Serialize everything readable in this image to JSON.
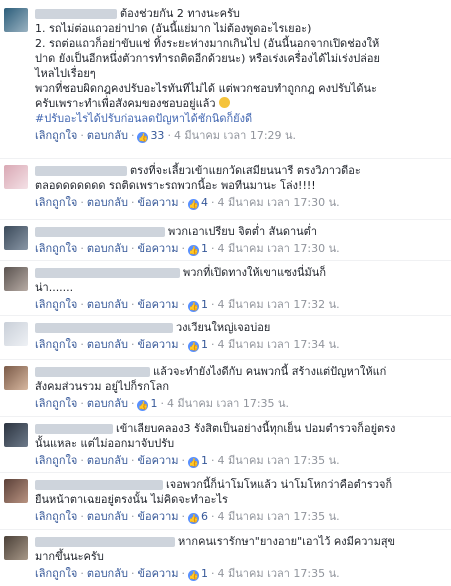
{
  "labels": {
    "like": "เลิกถูกใจ",
    "reply": "ตอบกลับ",
    "message": "ข้อความ"
  },
  "colors": {
    "link": "#365899",
    "meta": "#90949c",
    "hashtag": "#4267b2",
    "like_badge": "#5890ff"
  },
  "icons": {
    "like": "thumbs-up-icon",
    "emoji": "smile-emoji-icon"
  },
  "comments": [
    {
      "lines": [
        "ต้องช่วยกัน 2 ทางนะครับ",
        "1. รถไม่ต่อแถวอย่าปาด (อันนี้แย่มาก ไม่ต้องพูดอะไรเยอะ)",
        "2. รถต่อแถวก็อย่าขับแช่ ทิ้งระยะห่างมากเกินไป (อันนี้นอกจากเปิดช่องให้",
        "ปาด ยังเป็นอีกหนึ่งตัวการทำรถติดอีกด้วยนะ) หรือเร่งเครื่องได้ไม่เร่งปล่อย",
        "ไหลไปเรื่อยๆ",
        "พวกที่ชอบผิดกฎคงปรับอะไรทันทีไม่ได้ แต่พวกชอบทำถูกกฎ คงปรับได้นะ",
        "ครับเพราะทำเพื่อสังคมของชอบอยู่แล้ว",
        "#ปรับอะไรได้ปรับก่อนลดปัญหาได้ชักนิดก็ยังดี"
      ],
      "likes": "33",
      "time": "4 มีนาคม เวลา 17:29 น."
    },
    {
      "lines": [
        "ตรงที่จะเลี้ยวเข้าแยกวัดเสมียนนารี ตรงวิภาวดีอะ",
        "ตลอดดดดดดด รถติดเพราะรถพวกนี้อะ พอทีนมานะ โล่ง!!!!"
      ],
      "likes": "4",
      "time": "4 มีนาคม เวลา 17:30 น."
    },
    {
      "lines": [
        "พวกเอาเปรียบ จิตต่ำ สันดานต่ำ"
      ],
      "likes": "1",
      "time": "4 มีนาคม เวลา 17:30 น."
    },
    {
      "lines": [
        "พวกที่เปิดทางให้เขาแซงนี่มันก็",
        "น่า......."
      ],
      "likes": "1",
      "time": "4 มีนาคม เวลา 17:32 น."
    },
    {
      "lines": [
        "วงเวียนใหญ่เจอบ่อย"
      ],
      "likes": "1",
      "time": "4 มีนาคม เวลา 17:34 น."
    },
    {
      "lines": [
        "แล้วจะทำยังไงดีกับ คนพวกนี้ สร้างแต่ปัญหาให้แก่",
        "สังคมส่วนรวม อยู่ไปก็รกโลก"
      ],
      "likes": "1",
      "time": "4 มีนาคม เวลา 17:35 น."
    },
    {
      "lines": [
        "เข้าเลียบคลอง3 รังสิตเป็นอย่างนี้ทุกเย็น ปอมตำรวจก็อยู่ตรง",
        "นั้นแหละ แต่ไม่ออกมาจับปรับ"
      ],
      "likes": "1",
      "time": "4 มีนาคม เวลา 17:35 น."
    },
    {
      "lines": [
        "เจอพวกนี้ก็น่าโมโหแล้ว น่าโมโหกว่าคือตำรวจก็",
        "ยืนหน้าตาเฉยอยู่ตรงนั้น ไม่คิดจะทำอะไร"
      ],
      "likes": "6",
      "time": "4 มีนาคม เวลา 17:35 น."
    },
    {
      "lines": [
        "หากคนเรารักษา\"ยางอาย\"เอาไว้ คงมีความสุข",
        "มากขึ้นนะครับ"
      ],
      "likes": "1",
      "time": "4 มีนาคม เวลา 17:35 น."
    }
  ]
}
